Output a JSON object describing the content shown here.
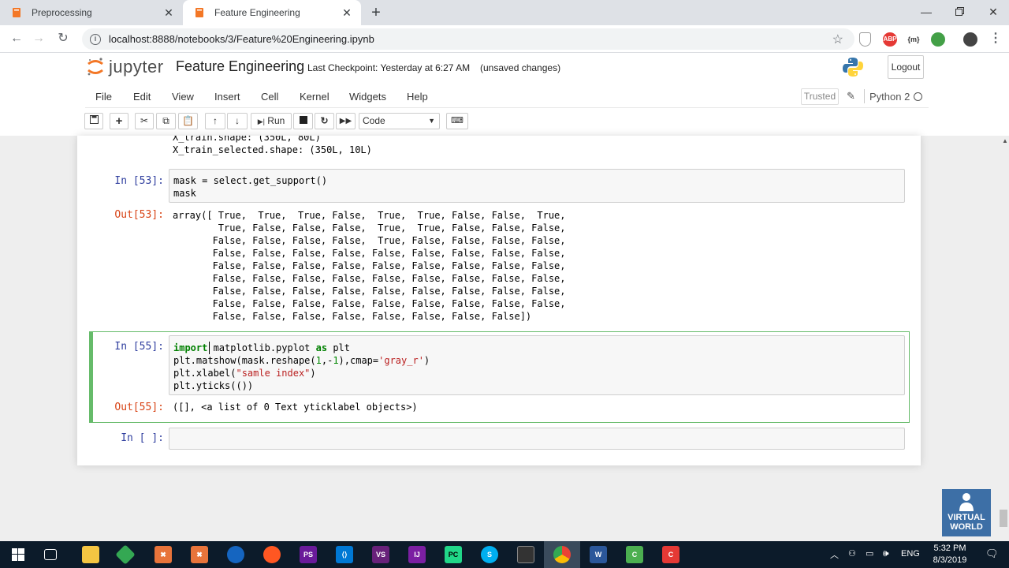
{
  "browser": {
    "tabs": [
      {
        "title": "Preprocessing",
        "active": false
      },
      {
        "title": "Feature Engineering",
        "active": true
      }
    ],
    "url": "localhost:8888/notebooks/3/Feature%20Engineering.ipynb",
    "extensions": [
      "ABP",
      "{m}"
    ]
  },
  "jupyter": {
    "logo_text": "jupyter",
    "notebook_title": "Feature Engineering",
    "checkpoint": "Last Checkpoint: Yesterday at 6:27 AM",
    "status": "(unsaved changes)",
    "logout_label": "Logout",
    "menu": [
      "File",
      "Edit",
      "View",
      "Insert",
      "Cell",
      "Kernel",
      "Widgets",
      "Help"
    ],
    "trusted_label": "Trusted",
    "kernel_name": "Python 2",
    "toolbar": {
      "run_label": "Run",
      "cell_type": "Code"
    }
  },
  "cells": {
    "prev_output": [
      "X_train.shape: (350L, 80L)",
      "X_train_selected.shape: (350L, 10L)"
    ],
    "c53": {
      "in_prompt": "In [53]:",
      "code": [
        "mask = select.get_support()",
        "mask"
      ],
      "out_prompt": "Out[53]:",
      "output": [
        "array([ True,  True,  True, False,  True,  True, False, False,  True,",
        "        True, False, False, False,  True,  True, False, False, False,",
        "       False, False, False, False,  True, False, False, False, False,",
        "       False, False, False, False, False, False, False, False, False,",
        "       False, False, False, False, False, False, False, False, False,",
        "       False, False, False, False, False, False, False, False, False,",
        "       False, False, False, False, False, False, False, False, False,",
        "       False, False, False, False, False, False, False, False, False,",
        "       False, False, False, False, False, False, False, False])"
      ]
    },
    "c55": {
      "in_prompt": "In [55]:",
      "code_l1_kw": "import",
      "code_l1_a": " matplotlib.pyplot ",
      "code_l1_kw2": "as",
      "code_l1_b": " plt",
      "code_l2_a": "plt.matshow(mask.reshape(",
      "code_l2_n1": "1",
      "code_l2_b": ",-",
      "code_l2_n2": "1",
      "code_l2_c": "),cmap=",
      "code_l2_s": "'gray_r'",
      "code_l2_d": ")",
      "code_l3_a": "plt.xlabel(",
      "code_l3_s": "\"samle index\"",
      "code_l3_b": ")",
      "code_l4": "plt.yticks(())",
      "out_prompt": "Out[55]:",
      "output": "([], <a list of 0 Text yticklabel objects>)"
    },
    "empty": {
      "in_prompt": "In [ ]:"
    }
  },
  "watermark": {
    "line1": "VIRTUAL",
    "line2": "WORLD"
  },
  "taskbar": {
    "lang": "ENG",
    "time": "5:32 PM",
    "date": "8/3/2019",
    "apps": [
      "PS",
      "VS",
      "IJ",
      "PC"
    ]
  }
}
